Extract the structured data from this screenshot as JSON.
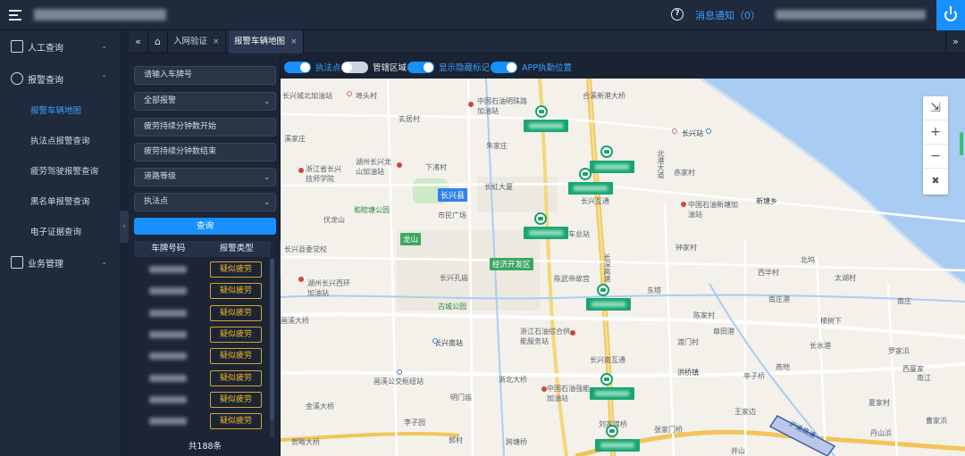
{
  "header": {
    "notice_label": "消息通知（0）"
  },
  "sidebar": {
    "groups": [
      {
        "label": "人工查询"
      },
      {
        "label": "报警查询"
      },
      {
        "label": "业务管理"
      }
    ],
    "alarm_items": [
      {
        "label": "报警车辆地图",
        "active": true
      },
      {
        "label": "执法点报警查询"
      },
      {
        "label": "疲劳驾驶报警查询"
      },
      {
        "label": "黑名单报警查询"
      },
      {
        "label": "电子证据查询"
      }
    ]
  },
  "tabs": [
    {
      "label": "入网验证"
    },
    {
      "label": "报警车辆地图",
      "active": true
    }
  ],
  "filters": {
    "plate_placeholder": "请输入车牌号",
    "alarm_type": "全部报警",
    "fatigue_start": "疲劳持续分钟数开始",
    "fatigue_end": "疲劳持续分钟数结束",
    "road_level": "道路等级",
    "enforcement_point": "执法点",
    "query_button": "查询"
  },
  "results": {
    "columns": [
      "车牌号码",
      "报警类型"
    ],
    "rows": [
      {
        "type": "疑似疲劳"
      },
      {
        "type": "疑似疲劳"
      },
      {
        "type": "疑似疲劳"
      },
      {
        "type": "疑似疲劳"
      },
      {
        "type": "疑似疲劳"
      },
      {
        "type": "疑似疲劳"
      },
      {
        "type": "疑似疲劳"
      },
      {
        "type": "疑似疲劳"
      }
    ],
    "total": "共188条"
  },
  "toggles": [
    {
      "label": "执法点",
      "on": true
    },
    {
      "label": "管辖区域",
      "on": false
    },
    {
      "label": "显示隐藏标记",
      "on": true
    },
    {
      "label": "APP执勤位置",
      "on": true
    }
  ],
  "map": {
    "labels": {
      "l1": "长兴城北加油站",
      "l2": "埠头村",
      "l3": "中国石油明珠路加油站",
      "l4": "合溪新港大桥",
      "l5": "玄居村",
      "l6": "长兴站",
      "l7": "溪家庄",
      "l8": "朱家庄",
      "l9": "北港大道",
      "l10": "浙江省长兴技师学院",
      "l11": "湖州长兴龙山加油站",
      "l12": "下渚村",
      "l13": "长虹大厦",
      "l14": "长兴互通",
      "l15": "新塘乡",
      "l16": "中国石油新塘加油站",
      "l17": "和睦塘公园",
      "l18": "市民广场",
      "l19": "伏龙山",
      "l20": "龙山",
      "l21": "车总站",
      "l22": "长兴县委党校",
      "l23": "钟家村",
      "l24": "经济开发区",
      "l25": "湖州长兴西环加油站",
      "l26": "长兴孔庙",
      "l27": "陈武帝故宫",
      "l28": "长深高速",
      "l29": "东塔",
      "l30": "南庄港",
      "l31": "画溪大桥",
      "l32": "古城公园",
      "l33": "陈家村",
      "l34": "长兴南站",
      "l35": "浙江石油综合供能服务站",
      "l36": "长兴南互通",
      "l37": "洪桥镇",
      "l38": "画溪公交枢纽站",
      "l39": "浙北大桥",
      "l40": "中国石油强能加油站",
      "l41": "亭子桥",
      "l42": "金溪大桥",
      "l43": "明门庙",
      "l44": "王家边",
      "l45": "刘家渡桥",
      "l46": "张家门桥",
      "l47": "李子园",
      "l48": "跨塘桥",
      "l49": "贺畈大桥",
      "l50": "郭村",
      "l51": "井山",
      "l52": "沪渝高速",
      "l53": "北坞",
      "l54": "太湖村",
      "l55": "西华村",
      "l56": "南庄",
      "l57": "章田港",
      "l58": "渡门村",
      "l59": "长水港",
      "l60": "罗家浜",
      "l61": "南江",
      "l62": "丹山浜",
      "l63": "西厦家",
      "l64": "曹家浜",
      "l65": "赤家村",
      "l66": "长兴县",
      "l67": "棱树下",
      "l68": "夏家村",
      "l69": "燕地"
    }
  },
  "colors": {
    "accent": "#1890ff",
    "warning": "#f0b429",
    "vehicle": "#17a672"
  }
}
